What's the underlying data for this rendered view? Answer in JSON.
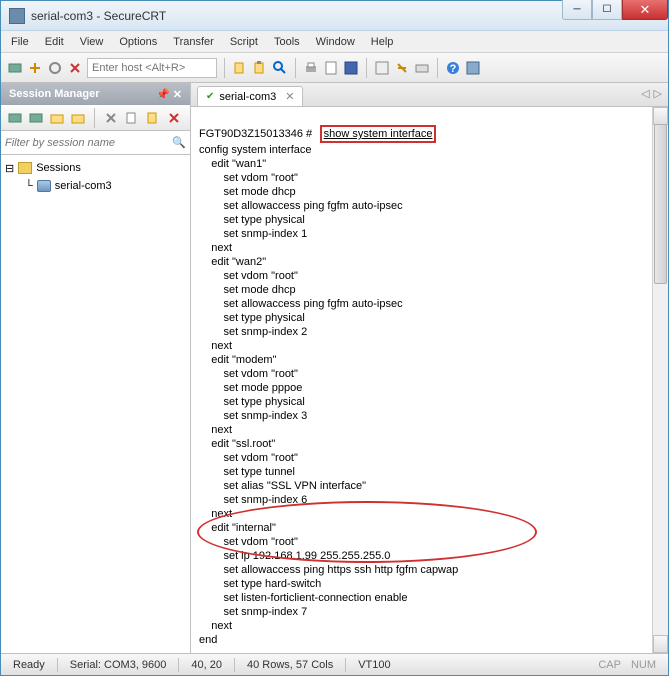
{
  "window": {
    "title": "serial-com3 - SecureCRT"
  },
  "menu": {
    "items": [
      "File",
      "Edit",
      "View",
      "Options",
      "Transfer",
      "Script",
      "Tools",
      "Window",
      "Help"
    ]
  },
  "toolbar": {
    "host_placeholder": "Enter host <Alt+R>"
  },
  "session_manager": {
    "title": "Session Manager",
    "filter_placeholder": "Filter by session name ",
    "root": "Sessions",
    "items": [
      "serial-com3"
    ]
  },
  "tabs": {
    "active": "serial-com3"
  },
  "terminal": {
    "prompt": "FGT90D3Z15013346 #",
    "highlight_cmd": "show system interface",
    "lines": [
      "config system interface",
      "    edit \"wan1\"",
      "        set vdom \"root\"",
      "        set mode dhcp",
      "        set allowaccess ping fgfm auto-ipsec",
      "        set type physical",
      "        set snmp-index 1",
      "    next",
      "    edit \"wan2\"",
      "        set vdom \"root\"",
      "        set mode dhcp",
      "        set allowaccess ping fgfm auto-ipsec",
      "        set type physical",
      "        set snmp-index 2",
      "    next",
      "    edit \"modem\"",
      "        set vdom \"root\"",
      "        set mode pppoe",
      "        set type physical",
      "        set snmp-index 3",
      "    next",
      "    edit \"ssl.root\"",
      "        set vdom \"root\"",
      "        set type tunnel",
      "        set alias \"SSL VPN interface\"",
      "        set snmp-index 6",
      "    next",
      "    edit \"internal\"",
      "        set vdom \"root\"",
      "        set ip 192.168.1.99 255.255.255.0",
      "        set allowaccess ping https ssh http fgfm capwap",
      "        set type hard-switch",
      "        set listen-forticlient-connection enable",
      "        set snmp-index 7",
      "    next",
      "end"
    ]
  },
  "statusbar": {
    "ready": "Ready",
    "port": "Serial: COM3, 9600",
    "pos": "40,  20",
    "dims": "40 Rows, 57 Cols",
    "term": "VT100",
    "caps": "CAP",
    "num": "NUM"
  }
}
